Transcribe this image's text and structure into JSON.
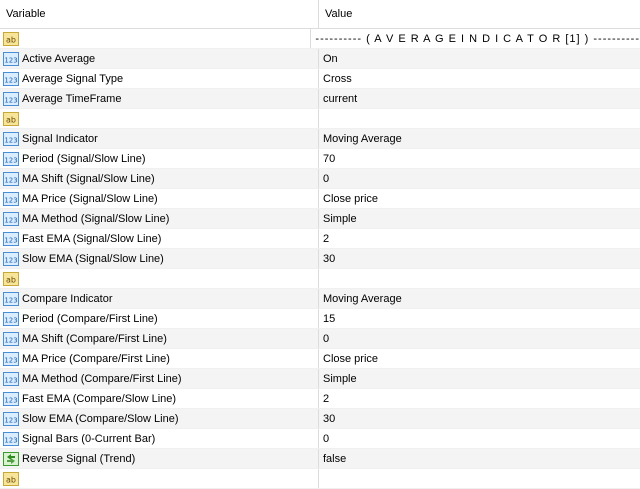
{
  "header": {
    "variable": "Variable",
    "value": "Value"
  },
  "rows": [
    {
      "icon": "text-icon",
      "label": "",
      "value": "---------- ( A V E R A G E  I N D I C A T O R  [1] ) ----------",
      "sep": true
    },
    {
      "icon": "number-icon",
      "label": "Active Average",
      "value": "On"
    },
    {
      "icon": "number-icon",
      "label": "Average Signal Type",
      "value": "Cross"
    },
    {
      "icon": "number-icon",
      "label": "Average TimeFrame",
      "value": "current"
    },
    {
      "icon": "text-icon",
      "label": "",
      "value": ""
    },
    {
      "icon": "number-icon",
      "label": "Signal Indicator",
      "value": "Moving Average"
    },
    {
      "icon": "number-icon",
      "label": "Period (Signal/Slow Line)",
      "value": "70"
    },
    {
      "icon": "number-icon",
      "label": "MA Shift (Signal/Slow Line)",
      "value": "0"
    },
    {
      "icon": "number-icon",
      "label": "MA Price (Signal/Slow Line)",
      "value": "Close price"
    },
    {
      "icon": "number-icon",
      "label": "MA Method (Signal/Slow Line)",
      "value": "Simple"
    },
    {
      "icon": "number-icon",
      "label": "Fast EMA (Signal/Slow Line)",
      "value": "2"
    },
    {
      "icon": "number-icon",
      "label": "Slow EMA (Signal/Slow Line)",
      "value": "30"
    },
    {
      "icon": "text-icon",
      "label": "",
      "value": ""
    },
    {
      "icon": "number-icon",
      "label": "Compare Indicator",
      "value": "Moving Average"
    },
    {
      "icon": "number-icon",
      "label": "Period (Compare/First Line)",
      "value": "15"
    },
    {
      "icon": "number-icon",
      "label": "MA Shift (Compare/First Line)",
      "value": "0"
    },
    {
      "icon": "number-icon",
      "label": "MA Price (Compare/First Line)",
      "value": "Close price"
    },
    {
      "icon": "number-icon",
      "label": "MA Method (Compare/First Line)",
      "value": "Simple"
    },
    {
      "icon": "number-icon",
      "label": "Fast EMA (Compare/Slow Line)",
      "value": "2"
    },
    {
      "icon": "number-icon",
      "label": "Slow EMA (Compare/Slow Line)",
      "value": "30"
    },
    {
      "icon": "number-icon",
      "label": "Signal Bars (0-Current Bar)",
      "value": "0"
    },
    {
      "icon": "bool-icon",
      "label": "Reverse Signal (Trend)",
      "value": "false"
    },
    {
      "icon": "text-icon",
      "label": "",
      "value": ""
    }
  ]
}
